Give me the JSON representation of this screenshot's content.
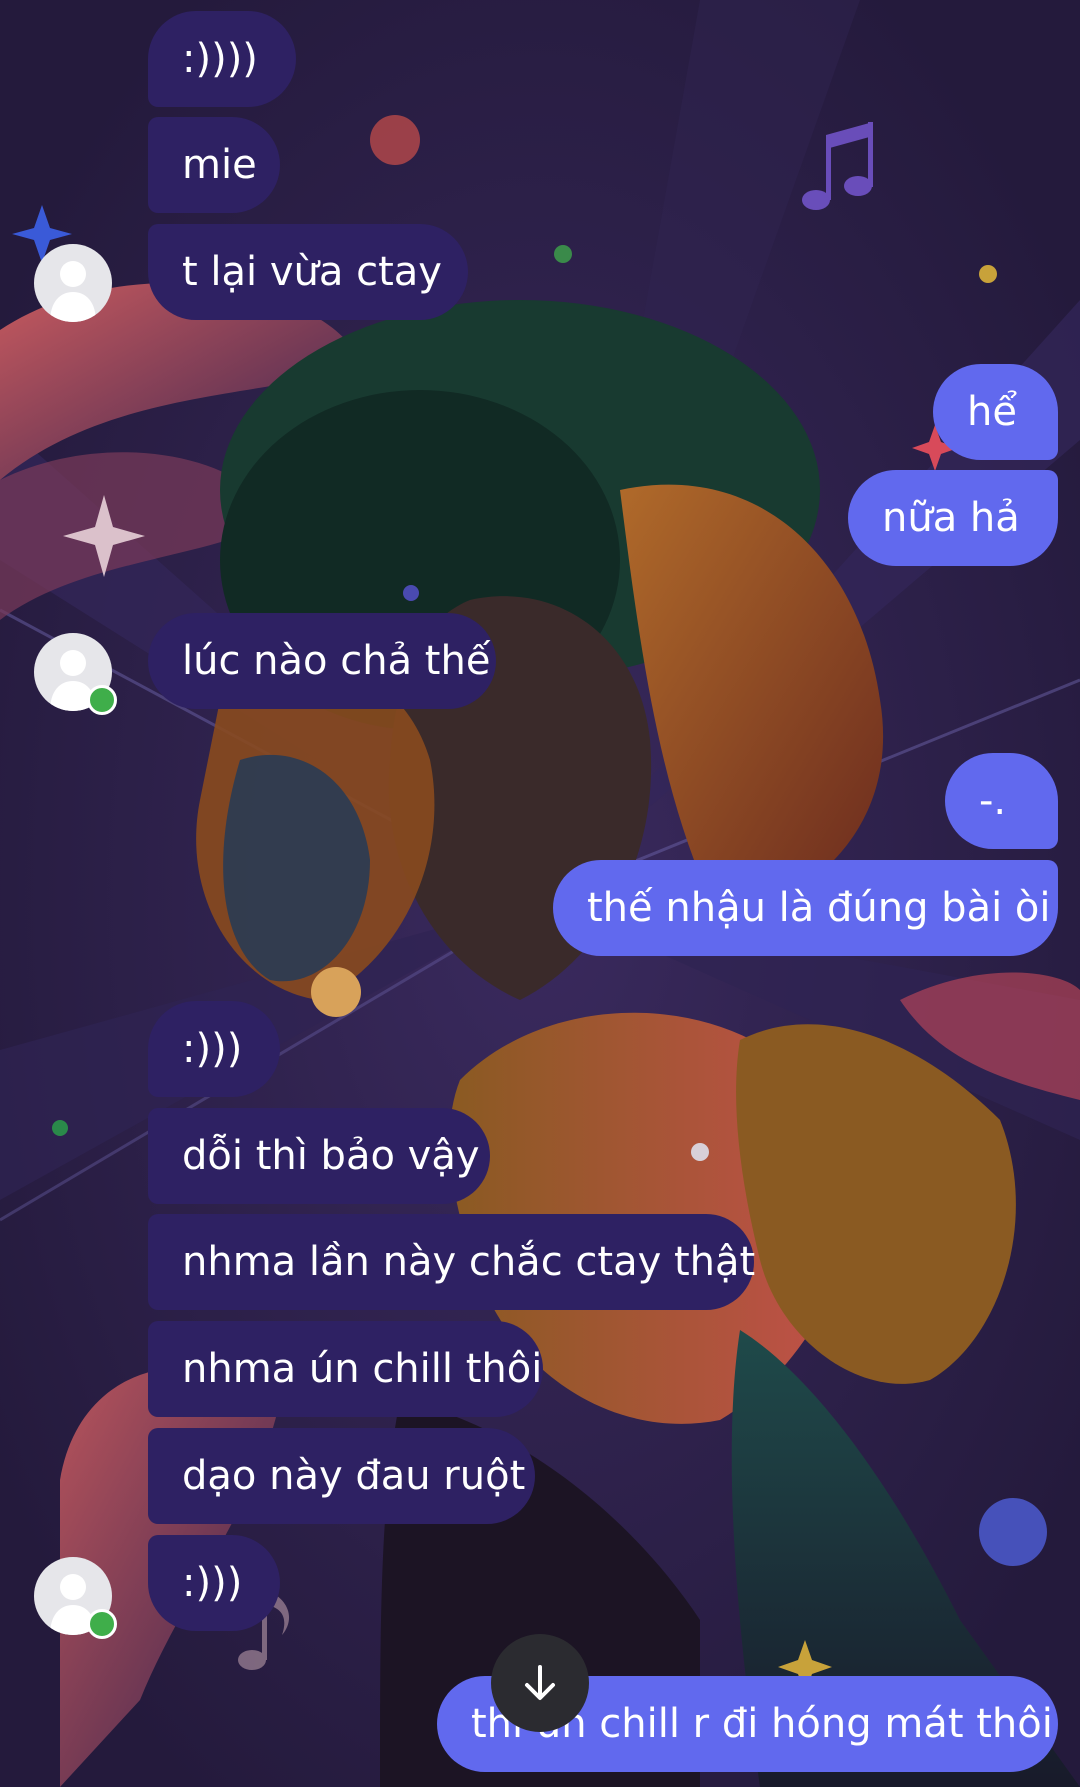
{
  "conversation": {
    "messages": [
      {
        "side": "in",
        "text": ":))))"
      },
      {
        "side": "in",
        "text": "mie"
      },
      {
        "side": "in",
        "text": "t lại vừa ctay"
      },
      {
        "side": "out",
        "text": "hể"
      },
      {
        "side": "out",
        "text": "nữa hả"
      },
      {
        "side": "in",
        "text": "lúc nào chả thế"
      },
      {
        "side": "out",
        "text": "-."
      },
      {
        "side": "out",
        "text": "thế nhậu là đúng bài òi"
      },
      {
        "side": "in",
        "text": ":)))"
      },
      {
        "side": "in",
        "text": "dỗi thì bảo vậy"
      },
      {
        "side": "in",
        "text": "nhma lần này chắc ctay thật"
      },
      {
        "side": "in",
        "text": "nhma ún chill thôi"
      },
      {
        "side": "in",
        "text": "dạo này đau ruột"
      },
      {
        "side": "in",
        "text": ":)))"
      },
      {
        "side": "out",
        "text": "thì ún chill r đi hóng mát thôi"
      }
    ]
  },
  "icons": {
    "avatar": "default-user-avatar-icon",
    "online": "online-status-dot",
    "scroll": "arrow-down-icon"
  },
  "colors": {
    "incoming_bubble": "#2e2163",
    "outgoing_bubble": "#6169ee",
    "background": "#2a1e45",
    "online_dot": "#3fae4a",
    "scroll_button": "#2b2b30"
  }
}
